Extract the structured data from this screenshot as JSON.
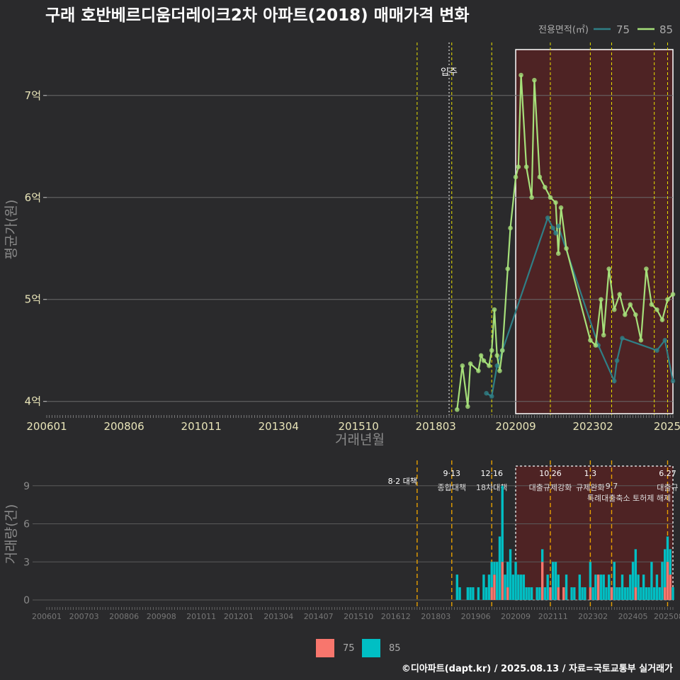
{
  "title": "구래 호반베르디움더레이크2차 아파트(2018) 매매가격 변화",
  "footer": "©디아파트(dapt.kr) / 2025.08.13 / 자료=국토교통부 실거래가",
  "legend_top": {
    "title": "전용면적(㎡)",
    "items": [
      {
        "name": "75",
        "color": "#2f7f86"
      },
      {
        "name": "85",
        "color": "#a6e07a"
      }
    ]
  },
  "legend_bottom": {
    "items": [
      {
        "name": "75",
        "color": "#f8766d"
      },
      {
        "name": "85",
        "color": "#00bfc4"
      }
    ]
  },
  "chart_data": [
    {
      "type": "line",
      "title": "구래 호반베르디움더레이크2차 아파트(2018) 매매가격 변화",
      "xlabel": "거래년월",
      "ylabel": "평균가(원)",
      "x_tick_labels": [
        "200601",
        "200806",
        "201011",
        "201304",
        "201510",
        "201803",
        "202009",
        "202302",
        "2025"
      ],
      "y_ticks": [
        {
          "value": 4,
          "label": "4억"
        },
        {
          "value": 5,
          "label": "5억"
        },
        {
          "value": 6,
          "label": "6억"
        },
        {
          "value": 7,
          "label": "7억"
        }
      ],
      "xlim": [
        "2006-01",
        "2025-08"
      ],
      "ylim": [
        3.88,
        7.45
      ],
      "y_unit": "억원",
      "annotations": [
        {
          "x": "2018-08",
          "label": "입주"
        }
      ],
      "highlight_range": [
        "2020-09",
        "2025-08"
      ],
      "event_lines": [
        "2017-08",
        "2018-09",
        "2019-12",
        "2021-10",
        "2023-01",
        "2023-09",
        "2025-01",
        "2025-06"
      ],
      "series": [
        {
          "name": "75",
          "color": "#2f7f86",
          "points": [
            [
              "2019-10",
              4.08
            ],
            [
              "2019-12",
              4.05
            ],
            [
              "2020-02",
              4.35
            ],
            [
              "2020-04",
              4.5
            ],
            [
              "2021-09",
              5.8
            ],
            [
              "2021-11",
              5.7
            ],
            [
              "2021-12",
              5.65
            ],
            [
              "2022-01",
              5.72
            ],
            [
              "2023-04",
              4.55
            ],
            [
              "2023-10",
              4.2
            ],
            [
              "2023-11",
              4.4
            ],
            [
              "2024-01",
              4.62
            ],
            [
              "2025-02",
              4.5
            ],
            [
              "2025-05",
              4.6
            ],
            [
              "2025-08",
              4.2
            ]
          ]
        },
        {
          "name": "85",
          "color": "#a6e07a",
          "points": [
            [
              "2018-11",
              3.92
            ],
            [
              "2019-01",
              4.35
            ],
            [
              "2019-03",
              3.95
            ],
            [
              "2019-04",
              4.37
            ],
            [
              "2019-07",
              4.3
            ],
            [
              "2019-08",
              4.45
            ],
            [
              "2019-09",
              4.4
            ],
            [
              "2019-11",
              4.35
            ],
            [
              "2019-12",
              4.5
            ],
            [
              "2020-01",
              4.9
            ],
            [
              "2020-02",
              4.45
            ],
            [
              "2020-03",
              4.3
            ],
            [
              "2020-04",
              4.5
            ],
            [
              "2020-06",
              5.3
            ],
            [
              "2020-07",
              5.7
            ],
            [
              "2020-09",
              6.2
            ],
            [
              "2020-10",
              6.3
            ],
            [
              "2020-11",
              7.2
            ],
            [
              "2021-01",
              6.3
            ],
            [
              "2021-03",
              6.0
            ],
            [
              "2021-04",
              7.15
            ],
            [
              "2021-06",
              6.2
            ],
            [
              "2021-08",
              6.1
            ],
            [
              "2021-10",
              6.0
            ],
            [
              "2021-12",
              5.95
            ],
            [
              "2022-01",
              5.45
            ],
            [
              "2022-02",
              5.9
            ],
            [
              "2022-04",
              5.5
            ],
            [
              "2023-01",
              4.6
            ],
            [
              "2023-03",
              4.55
            ],
            [
              "2023-05",
              5.0
            ],
            [
              "2023-06",
              4.65
            ],
            [
              "2023-08",
              5.3
            ],
            [
              "2023-10",
              4.9
            ],
            [
              "2023-12",
              5.05
            ],
            [
              "2024-02",
              4.85
            ],
            [
              "2024-04",
              4.95
            ],
            [
              "2024-06",
              4.85
            ],
            [
              "2024-08",
              4.6
            ],
            [
              "2024-10",
              5.3
            ],
            [
              "2024-12",
              4.95
            ],
            [
              "2025-02",
              4.9
            ],
            [
              "2025-04",
              4.8
            ],
            [
              "2025-06",
              5.0
            ],
            [
              "2025-08",
              5.05
            ]
          ]
        }
      ]
    },
    {
      "type": "bar",
      "stacked": true,
      "xlabel": "",
      "ylabel": "거래량(건)",
      "x_tick_labels": [
        "200601",
        "200703",
        "200806",
        "200908",
        "201011",
        "201201",
        "201304",
        "201407",
        "201510",
        "201612",
        "201803",
        "201906",
        "202009",
        "202111",
        "202302",
        "202405",
        "202508"
      ],
      "y_ticks": [
        0,
        3,
        6,
        9
      ],
      "ylim": [
        0,
        11.5
      ],
      "highlight_range": [
        "2020-09",
        "2025-08"
      ],
      "events": [
        {
          "x": "2017-08",
          "label": "8·2 대책",
          "label2": ""
        },
        {
          "x": "2018-09",
          "label": "9·13",
          "label2": "종합대책"
        },
        {
          "x": "2019-12",
          "label": "12·16",
          "label2": "18차대책"
        },
        {
          "x": "2021-10",
          "label": "10.26",
          "label2": "대출규제강화"
        },
        {
          "x": "2023-01",
          "label": "1.3",
          "label2": "규제완화"
        },
        {
          "x": "2023-09",
          "label": "",
          "label2": "9.7"
        },
        {
          "x": "2025-06",
          "label": "6.27",
          "label2": "대출규"
        }
      ],
      "event_label3": "특례대출축소 토허제 해제",
      "series": [
        {
          "name": "75",
          "color": "#f8766d",
          "values": [
            [
              "2019-12",
              1
            ],
            [
              "2020-01",
              2
            ],
            [
              "2020-04",
              3
            ],
            [
              "2020-06",
              1
            ],
            [
              "2021-07",
              3
            ],
            [
              "2021-10",
              1
            ],
            [
              "2022-01",
              1
            ],
            [
              "2022-03",
              1
            ],
            [
              "2023-01",
              1
            ],
            [
              "2023-04",
              2
            ],
            [
              "2023-09",
              1
            ],
            [
              "2024-06",
              1
            ],
            [
              "2025-05",
              1
            ],
            [
              "2025-06",
              3
            ],
            [
              "2025-07",
              2
            ]
          ]
        },
        {
          "name": "85",
          "color": "#00bfc4",
          "values": [
            [
              "2018-11",
              2
            ],
            [
              "2018-12",
              1
            ],
            [
              "2019-03",
              1
            ],
            [
              "2019-04",
              1
            ],
            [
              "2019-05",
              1
            ],
            [
              "2019-07",
              1
            ],
            [
              "2019-09",
              2
            ],
            [
              "2019-10",
              1
            ],
            [
              "2019-11",
              2
            ],
            [
              "2019-12",
              2
            ],
            [
              "2020-01",
              1
            ],
            [
              "2020-02",
              3
            ],
            [
              "2020-03",
              5
            ],
            [
              "2020-04",
              6
            ],
            [
              "2020-05",
              2
            ],
            [
              "2020-06",
              2
            ],
            [
              "2020-07",
              4
            ],
            [
              "2020-08",
              2
            ],
            [
              "2020-09",
              3
            ],
            [
              "2020-10",
              2
            ],
            [
              "2020-11",
              2
            ],
            [
              "2020-12",
              2
            ],
            [
              "2021-01",
              1
            ],
            [
              "2021-02",
              1
            ],
            [
              "2021-03",
              1
            ],
            [
              "2021-05",
              1
            ],
            [
              "2021-06",
              1
            ],
            [
              "2021-07",
              1
            ],
            [
              "2021-08",
              1
            ],
            [
              "2021-09",
              2
            ],
            [
              "2021-11",
              3
            ],
            [
              "2021-12",
              3
            ],
            [
              "2022-01",
              1
            ],
            [
              "2022-04",
              2
            ],
            [
              "2022-06",
              1
            ],
            [
              "2022-07",
              1
            ],
            [
              "2022-09",
              2
            ],
            [
              "2022-10",
              1
            ],
            [
              "2022-11",
              1
            ],
            [
              "2023-01",
              2
            ],
            [
              "2023-02",
              1
            ],
            [
              "2023-03",
              2
            ],
            [
              "2023-05",
              2
            ],
            [
              "2023-06",
              2
            ],
            [
              "2023-07",
              1
            ],
            [
              "2023-08",
              2
            ],
            [
              "2023-10",
              3
            ],
            [
              "2023-11",
              1
            ],
            [
              "2023-12",
              1
            ],
            [
              "2024-01",
              2
            ],
            [
              "2024-02",
              1
            ],
            [
              "2024-03",
              1
            ],
            [
              "2024-04",
              2
            ],
            [
              "2024-05",
              3
            ],
            [
              "2024-06",
              3
            ],
            [
              "2024-07",
              2
            ],
            [
              "2024-08",
              1
            ],
            [
              "2024-09",
              2
            ],
            [
              "2024-10",
              1
            ],
            [
              "2024-11",
              1
            ],
            [
              "2024-12",
              3
            ],
            [
              "2025-01",
              1
            ],
            [
              "2025-02",
              2
            ],
            [
              "2025-03",
              1
            ],
            [
              "2025-04",
              3
            ],
            [
              "2025-05",
              3
            ],
            [
              "2025-06",
              2
            ],
            [
              "2025-07",
              2
            ],
            [
              "2025-08",
              1
            ]
          ]
        }
      ]
    }
  ]
}
